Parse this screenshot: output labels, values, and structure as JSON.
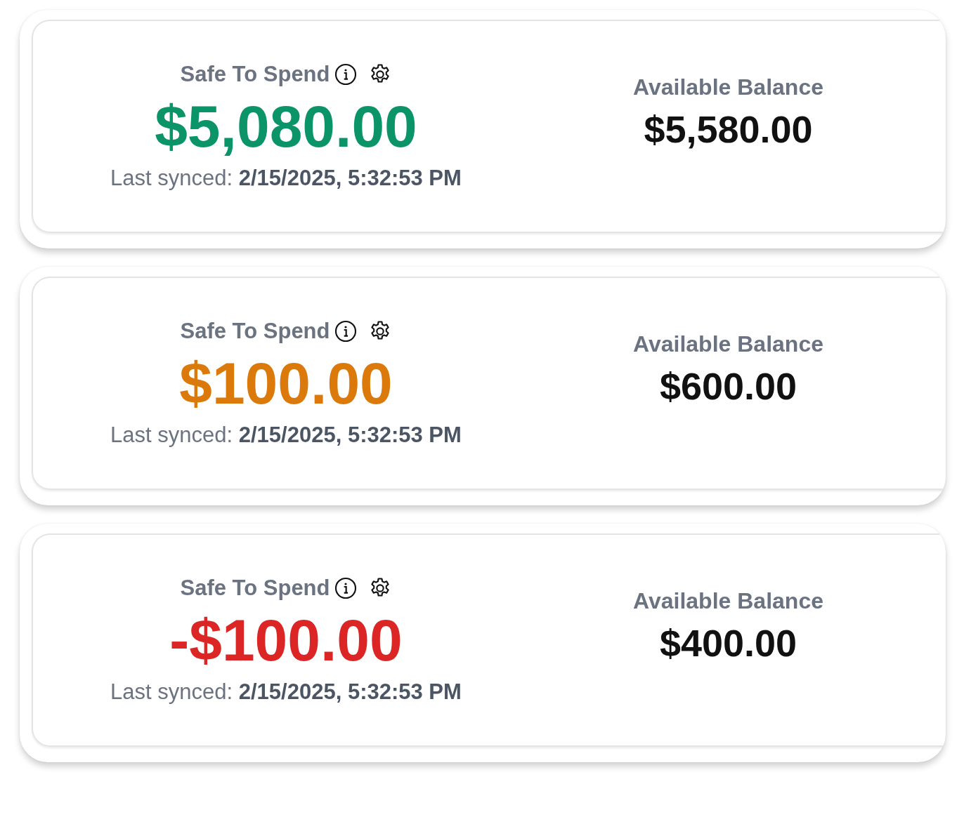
{
  "cards": [
    {
      "title": "Safe To Spend",
      "amount": "$5,080.00",
      "color": "#0b9467",
      "synced": "Last synced: **2/15/2025, 5:32:53 PM**",
      "balance_label": "Available Balance",
      "balance": "$5,580.00"
    },
    {
      "title": "Safe To Spend",
      "amount": "$100.00",
      "color": "#db7a0b",
      "synced": "Last synced: **2/15/2025, 5:32:53 PM**",
      "balance_label": "Available Balance",
      "balance": "$600.00"
    },
    {
      "title": "Safe To Spend",
      "amount": "-$100.00",
      "color": "#dc2626",
      "synced": "Last synced: **2/15/2025, 5:32:53 PM**",
      "balance_label": "Available Balance",
      "balance": "$400.00"
    }
  ]
}
